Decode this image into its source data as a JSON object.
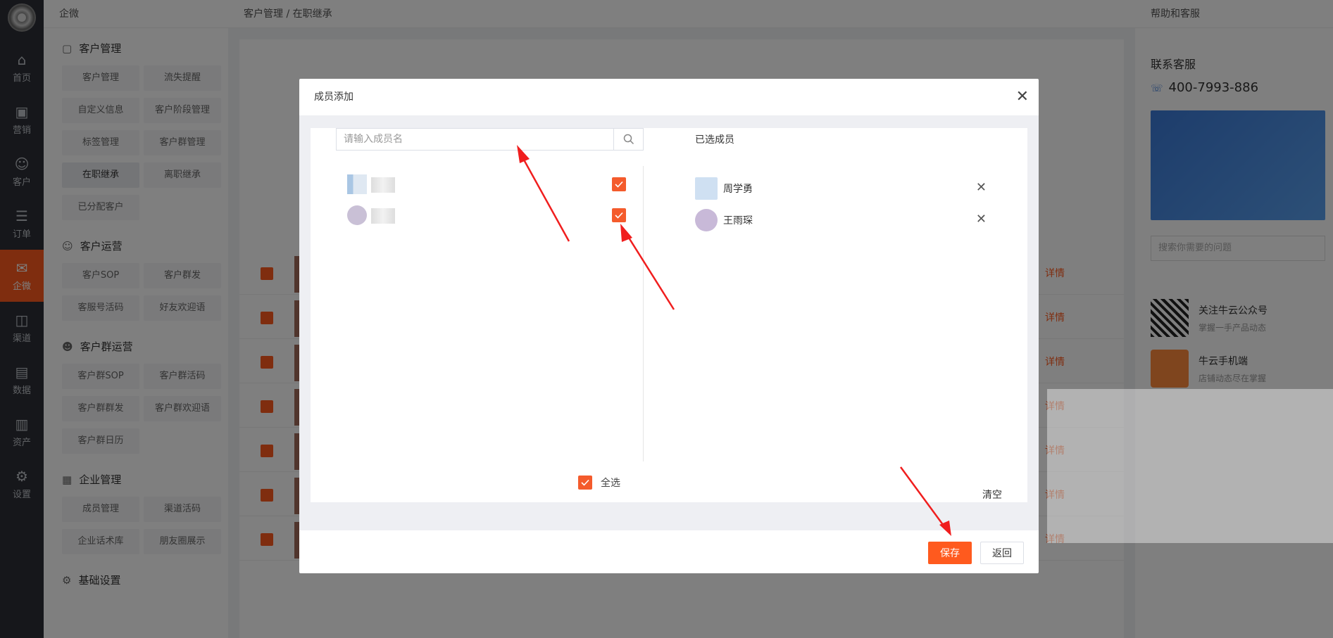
{
  "app": {
    "brand": "企微",
    "breadcrumb": "客户管理 / 在职继承",
    "iconbar": [
      {
        "label": "首页",
        "icon": "home-icon"
      },
      {
        "label": "营销",
        "icon": "marketing-icon"
      },
      {
        "label": "客户",
        "icon": "customer-icon"
      },
      {
        "label": "订单",
        "icon": "order-icon"
      },
      {
        "label": "企微",
        "icon": "wecom-icon"
      },
      {
        "label": "渠道",
        "icon": "channel-icon"
      },
      {
        "label": "数据",
        "icon": "data-icon"
      },
      {
        "label": "资产",
        "icon": "asset-icon"
      },
      {
        "label": "设置",
        "icon": "settings-icon"
      }
    ],
    "sidenav": {
      "groups": [
        {
          "title": "客户管理",
          "items": [
            "客户管理",
            "流失提醒",
            "自定义信息",
            "客户阶段管理",
            "标签管理",
            "客户群管理",
            "在职继承",
            "离职继承",
            "已分配客户"
          ]
        },
        {
          "title": "客户运营",
          "items": [
            "客户SOP",
            "客户群发",
            "客服号活码",
            "好友欢迎语"
          ]
        },
        {
          "title": "客户群运营",
          "items": [
            "客户群SOP",
            "客户群活码",
            "客户群群发",
            "客户群欢迎语",
            "客户群日历"
          ]
        },
        {
          "title": "企业管理",
          "items": [
            "成员管理",
            "渠道活码",
            "企业话术库",
            "朋友圈展示"
          ]
        },
        {
          "title": "基础设置",
          "items": []
        }
      ]
    },
    "table": {
      "detail_label": "详情"
    },
    "right_panel": {
      "top": "帮助和客服",
      "contact_title": "联系客服",
      "phone": "400-7993-886",
      "search_placeholder": "搜索你需要的问题",
      "follow_title": "关注牛云公众号",
      "follow_sub": "掌握一手产品动态",
      "app_title": "牛云手机端",
      "app_sub": "店铺动态尽在掌握"
    }
  },
  "modal": {
    "title": "成员添加",
    "search_placeholder": "请输入成员名",
    "selected_title": "已选成员",
    "selected": [
      {
        "name": "周学勇"
      },
      {
        "name": "王雨琛"
      }
    ],
    "select_all_label": "全选",
    "clear_label": "清空",
    "save_label": "保存",
    "back_label": "返回",
    "accent": "#ff5a1e"
  }
}
